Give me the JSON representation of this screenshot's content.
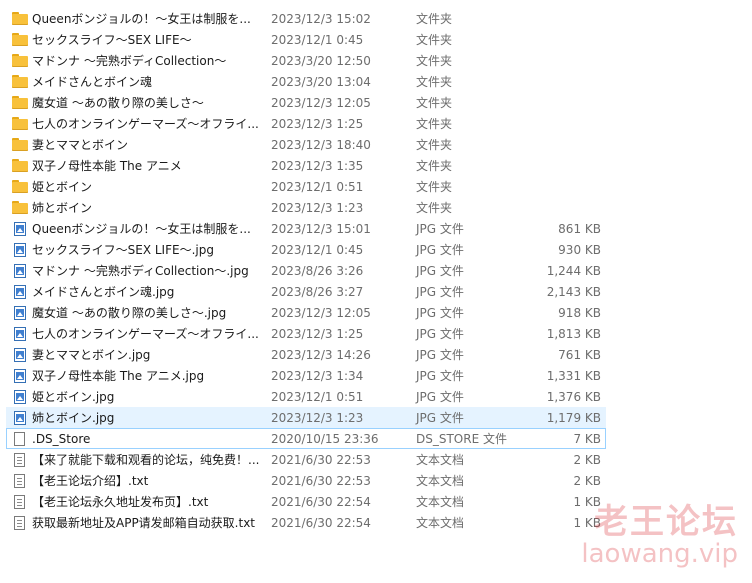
{
  "files": [
    {
      "icon": "folder-icon",
      "name": "Queenボンジョルの！～女王は制服を...",
      "date": "2023/12/3 15:02",
      "type": "文件夹",
      "size": ""
    },
    {
      "icon": "folder-icon",
      "name": "セックスライフ～SEX LIFE～",
      "date": "2023/12/1 0:45",
      "type": "文件夹",
      "size": ""
    },
    {
      "icon": "folder-icon",
      "name": "マドンナ ～完熟ボディCollection～",
      "date": "2023/3/20 12:50",
      "type": "文件夹",
      "size": ""
    },
    {
      "icon": "folder-icon",
      "name": "メイドさんとボイン魂",
      "date": "2023/3/20 13:04",
      "type": "文件夹",
      "size": ""
    },
    {
      "icon": "folder-icon",
      "name": "魔女道 ～あの散り際の美しさ～",
      "date": "2023/12/3 12:05",
      "type": "文件夹",
      "size": ""
    },
    {
      "icon": "folder-icon",
      "name": "七人のオンラインゲーマーズ～オフライ...",
      "date": "2023/12/3 1:25",
      "type": "文件夹",
      "size": ""
    },
    {
      "icon": "folder-icon",
      "name": "妻とママとボイン",
      "date": "2023/12/3 18:40",
      "type": "文件夹",
      "size": ""
    },
    {
      "icon": "folder-icon",
      "name": "双子ノ母性本能 The アニメ",
      "date": "2023/12/3 1:35",
      "type": "文件夹",
      "size": ""
    },
    {
      "icon": "folder-icon",
      "name": "姫とボイン",
      "date": "2023/12/1 0:51",
      "type": "文件夹",
      "size": ""
    },
    {
      "icon": "folder-icon",
      "name": "姉とボイン",
      "date": "2023/12/3 1:23",
      "type": "文件夹",
      "size": ""
    },
    {
      "icon": "image-file-icon",
      "name": "Queenボンジョルの！～女王は制服を...",
      "date": "2023/12/3 15:01",
      "type": "JPG 文件",
      "size": "861 KB"
    },
    {
      "icon": "image-file-icon",
      "name": "セックスライフ～SEX LIFE～.jpg",
      "date": "2023/12/1 0:45",
      "type": "JPG 文件",
      "size": "930 KB"
    },
    {
      "icon": "image-file-icon",
      "name": "マドンナ ～完熟ボディCollection～.jpg",
      "date": "2023/8/26 3:26",
      "type": "JPG 文件",
      "size": "1,244 KB"
    },
    {
      "icon": "image-file-icon",
      "name": "メイドさんとボイン魂.jpg",
      "date": "2023/8/26 3:27",
      "type": "JPG 文件",
      "size": "2,143 KB"
    },
    {
      "icon": "image-file-icon",
      "name": "魔女道 ～あの散り際の美しさ～.jpg",
      "date": "2023/12/3 12:05",
      "type": "JPG 文件",
      "size": "918 KB"
    },
    {
      "icon": "image-file-icon",
      "name": "七人のオンラインゲーマーズ～オフライ...",
      "date": "2023/12/3 1:25",
      "type": "JPG 文件",
      "size": "1,813 KB"
    },
    {
      "icon": "image-file-icon",
      "name": "妻とママとボイン.jpg",
      "date": "2023/12/3 14:26",
      "type": "JPG 文件",
      "size": "761 KB"
    },
    {
      "icon": "image-file-icon",
      "name": "双子ノ母性本能 The アニメ.jpg",
      "date": "2023/12/3 1:34",
      "type": "JPG 文件",
      "size": "1,331 KB"
    },
    {
      "icon": "image-file-icon",
      "name": "姫とボイン.jpg",
      "date": "2023/12/1 0:51",
      "type": "JPG 文件",
      "size": "1,376 KB"
    },
    {
      "icon": "image-file-icon",
      "name": "姉とボイン.jpg",
      "date": "2023/12/3 1:23",
      "type": "JPG 文件",
      "size": "1,179 KB",
      "state": "hover"
    },
    {
      "icon": "generic-file-icon",
      "name": ".DS_Store",
      "date": "2020/10/15 23:36",
      "type": "DS_STORE 文件",
      "size": "7 KB",
      "state": "selected"
    },
    {
      "icon": "text-file-icon",
      "name": "【来了就能下载和观看的论坛，纯免费！...",
      "date": "2021/6/30 22:53",
      "type": "文本文档",
      "size": "2 KB"
    },
    {
      "icon": "text-file-icon",
      "name": "【老王论坛介绍】.txt",
      "date": "2021/6/30 22:53",
      "type": "文本文档",
      "size": "2 KB"
    },
    {
      "icon": "text-file-icon",
      "name": "【老王论坛永久地址发布页】.txt",
      "date": "2021/6/30 22:54",
      "type": "文本文档",
      "size": "1 KB"
    },
    {
      "icon": "text-file-icon",
      "name": "获取最新地址及APP请发邮箱自动获取.txt",
      "date": "2021/6/30 22:54",
      "type": "文本文档",
      "size": "1 KB"
    }
  ],
  "watermark": {
    "line1": "老王论坛",
    "line2": "laowang.vip"
  },
  "colors": {
    "selection_border": "#99d1ff",
    "hover_bg": "#e5f3ff",
    "folder": "#f8c13b",
    "image_icon": "#3f7fd0",
    "watermark": "#d9282f"
  }
}
